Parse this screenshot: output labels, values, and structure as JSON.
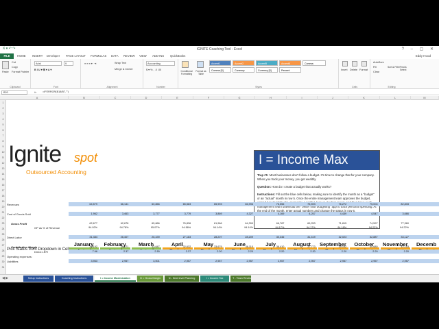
{
  "window": {
    "title": "IGNITE Coaching Tool - Excel",
    "user": "Eddy Hood"
  },
  "tabs": [
    "FILE",
    "HOME",
    "INSERT",
    "Developer",
    "PAGE LAYOUT",
    "FORMULAS",
    "DATA",
    "REVIEW",
    "VIEW",
    "ADD-INS",
    "QuickBooks"
  ],
  "ribbon": {
    "clipboard": {
      "label": "Clipboard",
      "paste": "Paste",
      "cut": "Cut",
      "copy": "Copy",
      "format_painter": "Format Painter"
    },
    "font": {
      "label": "Font",
      "name": "Arial",
      "size": "9"
    },
    "alignment": {
      "label": "Alignment",
      "wrap": "Wrap Text",
      "merge": "Merge & Center"
    },
    "number": {
      "label": "Number",
      "format": "Accounting"
    },
    "styles": {
      "label": "Styles",
      "conditional": "Conditional Formatting",
      "format_as_table": "Format as Table",
      "cells": [
        "Accent1",
        "Accent2",
        "Accent5",
        "Accent6",
        "Comma",
        "Comma [0]",
        "Currency",
        "Currency [0]",
        "Percent"
      ]
    },
    "cells": {
      "label": "Cells",
      "insert": "Insert",
      "delete": "Delete",
      "format": "Format"
    },
    "editing": {
      "label": "Editing",
      "autosum": "AutoSum",
      "fill": "Fill",
      "clear": "Clear",
      "sort": "Sort & Filter",
      "find": "Find & Select"
    }
  },
  "formula_bar": {
    "cell": "B20",
    "fx": "fx",
    "formula": "=IFERROR(B18/B7,\"\")"
  },
  "columns": [
    "A",
    "B",
    "C",
    "D",
    "E",
    "F",
    "G",
    "H",
    "I",
    "J",
    "K",
    "L",
    "M"
  ],
  "logo": {
    "text_main": "Ignite",
    "text_spot": "spot",
    "tagline": "Outsourced Accounting"
  },
  "infobox": {
    "title": "I = Income Max",
    "trap_label": "Trap #1:",
    "trap_text": "Most businesses don't follow a budget. It's time to change that for your company. When you track your money, you get wealthy.",
    "question_label": "Question:",
    "question_text": "How do I create a budget that actually works?",
    "instructions_label": "Instructions:",
    "instructions_text": "Fill out the blue cells below, making sure to identify the month as a \"budget\" or an \"actual\" month in row 5. Once the entire management team approves the budget, upload it to QuickBooks, memorize a profit & loss vs. budget report, and then have each management team download the \"better than budgeting\" app to track personal spending. At the end of the month, enter actual numbers and change the status in row 6."
  },
  "table": {
    "pick_label": "Pick Status from Dropdown in Cell",
    "months": [
      "January",
      "February",
      "March",
      "April",
      "May",
      "June",
      "July",
      "August",
      "September",
      "October",
      "November",
      "Decemb"
    ],
    "statuses": [
      "Actual",
      "Actual",
      "Actual",
      "Budget",
      "Budget",
      "Budget",
      "Budget",
      "Budget",
      "Budget",
      "Budget",
      "Budget",
      "Budget"
    ],
    "rows": [
      {
        "label": "Revenues",
        "style": "plain",
        "values": [
          "64,579",
          "66,141",
          "60,866",
          "65,583",
          "65,993",
          "66,996",
          "76,556",
          "75,593",
          "76,272",
          "75,004",
          "82,833",
          ""
        ]
      },
      {
        "label": "Cost of Goods Sold",
        "style": "plain",
        "values": [
          "1,962",
          "3,463",
          "3,777",
          "3,779",
          "3,869",
          "4,327",
          "4,169",
          "4,257",
          "4,439",
          "4,547",
          "3,666",
          ""
        ]
      },
      {
        "label": "Gross Profit",
        "style": "bi",
        "values": [
          "62,677",
          "62,678",
          "65,866",
          "76,836",
          "61,966",
          "64,399",
          "66,787",
          "69,253",
          "71,815",
          "74,597",
          "77,360",
          ""
        ]
      },
      {
        "label": "GP as % of Revenue",
        "style": "plain",
        "values": [
          "94.92%",
          "94.78%",
          "95.07%",
          "94.56%",
          "94.14%",
          "94.14%",
          "94.17%",
          "94.17%",
          "94.18%",
          "94.22%",
          "94.22%",
          ""
        ]
      },
      {
        "label": "Direct Labor",
        "style": "plain",
        "values": [
          "31,484",
          "26,407",
          "26,439",
          "27,183",
          "28,207",
          "28,209",
          "30,346",
          "31,419",
          "32,023",
          "32,887",
          "33,127",
          ""
        ]
      },
      {
        "label": "Contribution Margin",
        "style": "bi",
        "values": [
          "30,192",
          "36,271",
          "43,647",
          "32,632",
          "33,679",
          "36,110",
          "36,410",
          "37,773",
          "39,192",
          "40,680",
          "42,153",
          ""
        ]
      },
      {
        "label": "Direct LEFI",
        "style": "plain",
        "values": [
          "7.96",
          "2.37",
          "2.50",
          "2.37",
          "2.20",
          "2.20",
          "2.20",
          "2.20",
          "2.20",
          "2.20",
          "2.20",
          ""
        ]
      },
      {
        "label": "Operating expenses:",
        "style": "plain",
        "values": [
          "",
          "",
          "",
          "",
          "",
          "",
          "",
          "",
          "",
          "",
          "",
          ""
        ]
      },
      {
        "label": "Liabilities",
        "style": "plain",
        "values": [
          "3,963",
          "2,957",
          "3,001",
          "2,957",
          "2,957",
          "2,957",
          "2,957",
          "2,957",
          "2,957",
          "2,957",
          "2,957",
          ""
        ]
      }
    ]
  },
  "sheet_tabs": [
    {
      "label": "Setup Instructions",
      "kind": "blue"
    },
    {
      "label": "Coaching Instructions",
      "kind": "blue"
    },
    {
      "label": "I = Income Maximization",
      "kind": "active"
    },
    {
      "label": "G = Gross Margin",
      "kind": "green"
    },
    {
      "label": "N - Next level Planning",
      "kind": "olive"
    },
    {
      "label": "I = Income Tax",
      "kind": "teal"
    },
    {
      "label": "T - Team Reviews",
      "kind": "olive"
    }
  ],
  "colors": {
    "excel_green": "#217346",
    "header_blue": "#2a5298",
    "actual_green": "#92c050",
    "budget_orange": "#f4a51c",
    "band_blue": "#bcd3ee",
    "logo_orange": "#f28c00"
  }
}
